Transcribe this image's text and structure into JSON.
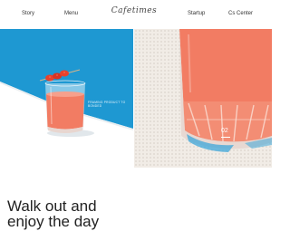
{
  "header": {
    "nav_left": [
      "Story",
      "Menu"
    ],
    "logo": "Cafetimes",
    "nav_right": [
      "Startup",
      "Cs Center"
    ]
  },
  "hero": {
    "left_tagline": "FRAMING PRODUCT TO BONDED",
    "slide_number": "02"
  },
  "main": {
    "headline_line1": "Walk out and",
    "headline_line2": "enjoy the day"
  },
  "colors": {
    "left_bg": "#1e98d2",
    "right_bg": "#f1ece6",
    "drink": "#f27c63"
  }
}
